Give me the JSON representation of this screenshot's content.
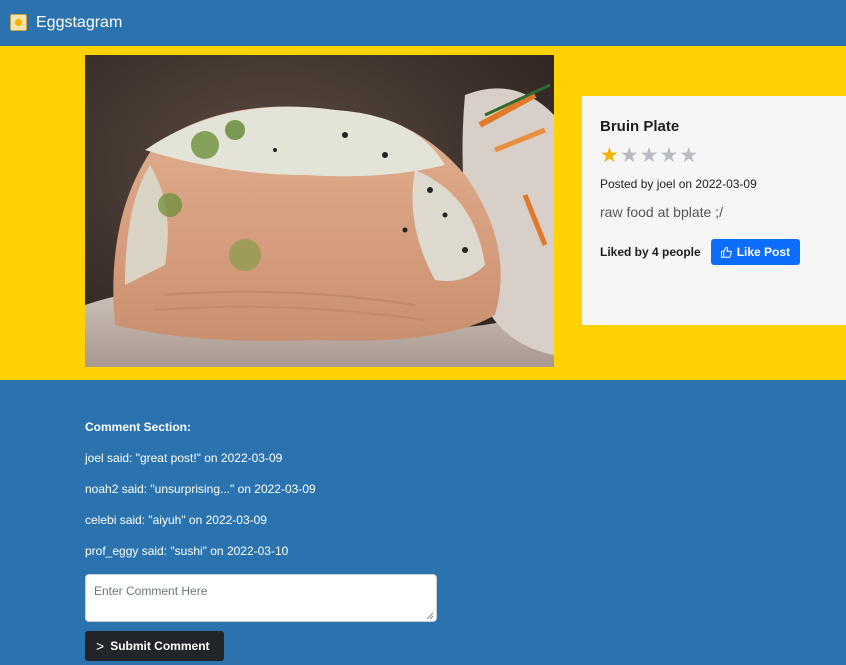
{
  "app": {
    "title": "Eggstagram",
    "logo_icon": "app-logo-icon"
  },
  "post": {
    "title": "Bruin Plate",
    "rating": 1,
    "rating_max": 5,
    "stars": {
      "filled": "★",
      "empty": "★★★★"
    },
    "posted_by": "Posted by joel on 2022-03-09",
    "description": "raw food at bplate ;/",
    "likes_text": "Liked by 4 people",
    "like_button_label": "Like Post",
    "like_icon": "thumbs-up-icon"
  },
  "comments": {
    "heading": "Comment Section:",
    "items": [
      "joel said: \"great post!\" on 2022-03-09",
      "noah2 said: \"unsurprising...\" on 2022-03-09",
      "celebi said: \"aiyuh\" on 2022-03-09",
      "prof_eggy said: \"sushi\" on 2022-03-10"
    ],
    "input_placeholder": "Enter Comment Here",
    "submit_label": "Submit Comment",
    "submit_icon": "chevron-right-icon"
  },
  "colors": {
    "navbar": "#2a73ae",
    "hero_background": "#ffd200",
    "primary_button": "#0d6efd",
    "dark_button": "#212529",
    "star_filled": "#f2b400",
    "star_empty": "#b8bcc2"
  }
}
